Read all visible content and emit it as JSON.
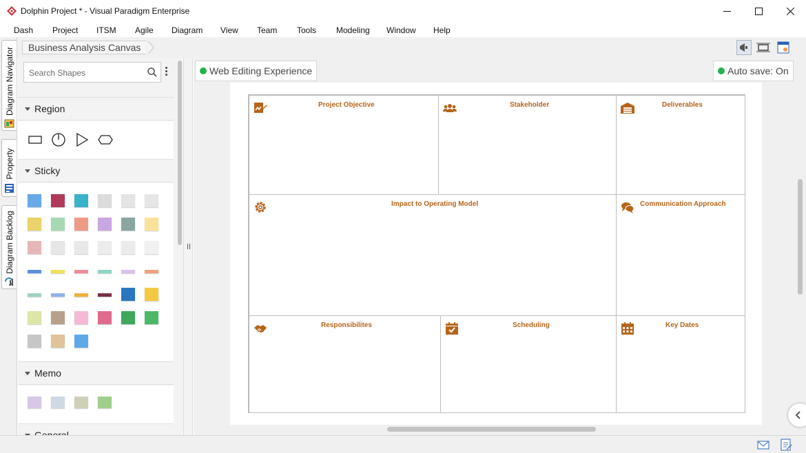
{
  "window": {
    "title": "Dolphin Project * - Visual Paradigm Enterprise",
    "minimize_glyph": "—",
    "maximize_glyph": "☐",
    "close_glyph": "✕"
  },
  "menu": [
    "Dash",
    "Project",
    "ITSM",
    "Agile",
    "Diagram",
    "View",
    "Team",
    "Tools",
    "Modeling",
    "Window",
    "Help"
  ],
  "side_tabs": [
    {
      "label": "Diagram Navigator",
      "icon": "diagram-navigator-icon"
    },
    {
      "label": "Property",
      "icon": "property-icon"
    },
    {
      "label": "Diagram Backlog",
      "icon": "diagram-backlog-icon"
    }
  ],
  "breadcrumb": "Business Analysis Canvas",
  "toolbar_icons": [
    "announcement-icon",
    "fit-diagram-icon",
    "diagram-settings-icon"
  ],
  "shapes_panel": {
    "search_placeholder": "Search Shapes",
    "sections": [
      {
        "title": "Region",
        "shapes": [
          "rectangle-shape",
          "circle-shape",
          "triangle-shape",
          "hexagon-shape"
        ]
      },
      {
        "title": "Sticky",
        "shape_count": 41
      },
      {
        "title": "Memo",
        "shape_count": 4
      },
      {
        "title": "General"
      }
    ]
  },
  "status": {
    "web_editing": "Web Editing Experience",
    "auto_save": "Auto save: On",
    "indicator_color": "#22b24c"
  },
  "canvas": {
    "accent_color": "#b5641a",
    "cells": [
      {
        "title": "Project Objective",
        "icon": "edit-signature-icon"
      },
      {
        "title": "Stakeholder",
        "icon": "people-group-icon"
      },
      {
        "title": "Deliverables",
        "icon": "warehouse-icon"
      },
      {
        "title": "Impact to Operating Model",
        "icon": "gear-icon"
      },
      {
        "title": "Communication Approach",
        "icon": "chat-bubbles-icon"
      },
      {
        "title": "Responsibilites",
        "icon": "handshake-icon"
      },
      {
        "title": "Scheduling",
        "icon": "calendar-check-icon"
      },
      {
        "title": "Key Dates",
        "icon": "calendar-grid-icon"
      }
    ]
  },
  "statusbar_icons": [
    "mail-icon",
    "notes-icon"
  ]
}
